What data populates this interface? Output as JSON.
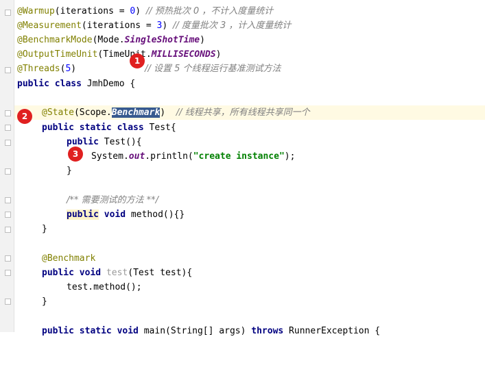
{
  "code": {
    "l1": {
      "anno": "@Warmup",
      "args": "(iterations = ",
      "num": "0",
      "close": ")",
      "comment": "// 预热批次 0 ，不计入度量统计"
    },
    "l2": {
      "anno": "@Measurement",
      "args": "(iterations = ",
      "num": "3",
      "close": ")",
      "comment": "// 度量批次 3 ，计入度量统计"
    },
    "l3": {
      "anno": "@BenchmarkMode",
      "args": "(Mode.",
      "field": "SingleShotTime",
      "close": ")"
    },
    "l4": {
      "anno": "@OutputTimeUnit",
      "args": "(TimeUnit.",
      "field": "MILLISECONDS",
      "close": ")"
    },
    "l5": {
      "anno": "@Threads",
      "args": "(",
      "num": "5",
      "close": ")",
      "comment": "// 设置 5 个线程运行基准测试方法"
    },
    "l6": {
      "kw": "public class",
      "name": " JmhDemo {"
    },
    "l8": {
      "anno": "@State",
      "args": "(Scope.",
      "field": "Benchmark",
      "close": ")",
      "comment": "// 线程共享，所有线程共享同一个"
    },
    "l9": {
      "kw": "public static class",
      "name": " Test{"
    },
    "l10": {
      "kw": "public",
      "name": " Test(){"
    },
    "l11": {
      "pre": "System.",
      "field": "out",
      "post": ".println(",
      "str": "\"create instance\"",
      "end": ");"
    },
    "l12": {
      "text": "}"
    },
    "l14": {
      "doc": "/** 需要测试的方法 **/"
    },
    "l15": {
      "kw": "public",
      "kw2": "void",
      "name": " method(){}"
    },
    "l16": {
      "text": "}"
    },
    "l18": {
      "anno": "@Benchmark"
    },
    "l19": {
      "kw": "public",
      "kw2": "void",
      "unused": "test",
      "args": "(Test test){"
    },
    "l20": {
      "text": "test.method();"
    },
    "l21": {
      "text": "}"
    },
    "l23": {
      "kw": "public static void",
      "name": " main(String[] args) ",
      "kw3": "throws",
      "post": " RunnerException {"
    }
  },
  "markers": [
    "1",
    "2",
    "3"
  ]
}
